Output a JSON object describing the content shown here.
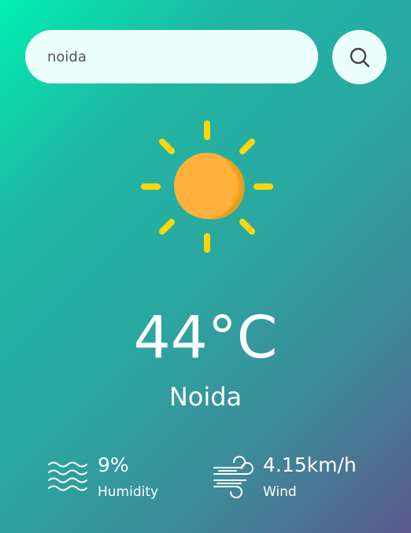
{
  "search": {
    "value": "noida",
    "button_icon": "search-icon"
  },
  "weather": {
    "icon": "sun-icon",
    "temperature": "44°C",
    "city": "Noida"
  },
  "humidity": {
    "icon": "waves-icon",
    "value": "9%",
    "label": "Humidity"
  },
  "wind": {
    "icon": "wind-icon",
    "value": "4.15km/h",
    "label": "Wind"
  },
  "colors": {
    "gradient_start": "#00f0b0",
    "gradient_end": "#5b5a8a",
    "input_bg": "#ecfffb",
    "sun_core": "#ffb13b",
    "sun_rays": "#ffd60a"
  }
}
